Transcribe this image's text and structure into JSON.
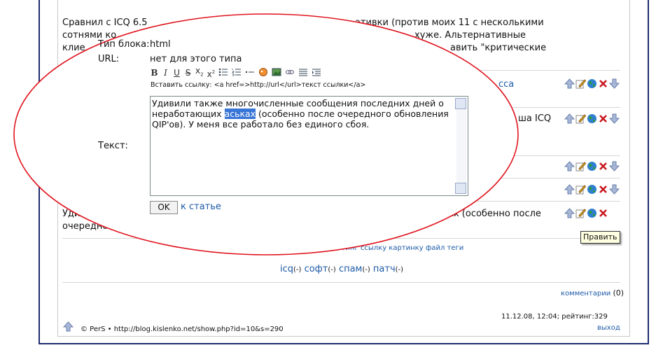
{
  "post": {
    "line1": "Сравнил с ICQ 6.5",
    "line1_right": "ативки (против моих 11 с несколькими",
    "line2": "сотнями ко",
    "line2_right": "хуже. Альтернативные",
    "line3": "клие",
    "line3_right": "авить \"критические"
  },
  "form": {
    "block_type_label": "Тип блока:",
    "block_type_value": "html",
    "url_label": "URL:",
    "url_value": "нет для этого типа",
    "text_label": "Текст:",
    "link_hint": "Вставить ссылку: <a href=>http://url</url>текст ссылки</a>",
    "editor_before": "Удивили также многочисленные сообщения последних дней о\nнеработающих ",
    "editor_selected": "аськах",
    "editor_after": " (особенно после очередного обновления\nQIP'ов). У меня все работало без единого сбоя.",
    "ok_label": "OK",
    "back_link": "к статье",
    "toolbar": {
      "bold": "B",
      "italic": "I",
      "underline": "U",
      "strike": "S",
      "sub": "x",
      "sup": "x"
    }
  },
  "comments": {
    "link_fragment": "сса",
    "icq_fragment": "ша ICQ",
    "last_line1_left": "Удиви",
    "last_line1_right": "ах (особенно после",
    "last_line2": "очередного"
  },
  "tooltip": "Править",
  "tags_line": "кет листинг ссылку картинку файл теги",
  "tags": {
    "icq": "icq",
    "icq_count": "(-)",
    "soft": "софт",
    "soft_count": "(-)",
    "spam": "спам",
    "spam_count": "(-)",
    "patch": "патч",
    "patch_count": "(-)"
  },
  "footer": {
    "comments_link": "комментарии",
    "comments_count": "(0)",
    "date_rating": "11.12.08, 12:04; рейтинг:329",
    "copyright": "© PerS • http://blog.kislenko.net/show.php?id=10&s=290",
    "exit": "выход"
  },
  "colors": {
    "frame": "#1e2c6e",
    "link": "#1e5ba8",
    "ellipse": "#e0141e",
    "selection": "#3875d7",
    "tooltip_bg": "#ffffe1"
  },
  "icons": [
    "up-arrow-icon",
    "edit-icon",
    "globe-icon",
    "delete-icon",
    "down-arrow-icon"
  ]
}
